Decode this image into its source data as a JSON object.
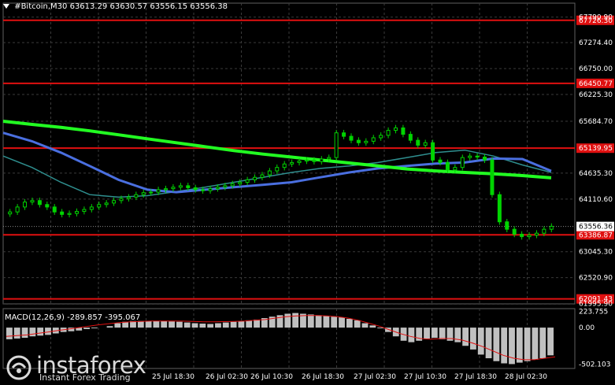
{
  "header": {
    "symbol": "#Bitcoin,M30",
    "ohlc": "63613.29 63630.57 63556.15 63556.38"
  },
  "macd": {
    "label": "MACD(12,26,9) -289.857 -395.067"
  },
  "logo": {
    "brand": "instaforex",
    "tagline": "Instant Forex Trading",
    "icon": "instaforex-logo-icon"
  },
  "colors": {
    "background": "#000000",
    "grid": "#3a3a3a",
    "candle": "#00d400",
    "ma_green": "#22ff22",
    "ma_blue": "#4a6fe0",
    "ma_teal": "#2f8f8f",
    "level": "#e01010",
    "current_price_box": "#ffffff",
    "macd_hist": "#c0c0c0",
    "macd_signal": "#e01010"
  },
  "chart_data": {
    "type": "candlestick",
    "title": "#Bitcoin,M30",
    "price_axis": {
      "ticks": [
        "67790.90",
        "67274.40",
        "66750.00",
        "66225.30",
        "65684.70",
        "64635.30",
        "64110.60",
        "63045.30",
        "62520.90",
        "61995.90"
      ],
      "ylim": [
        61990,
        67850
      ]
    },
    "time_axis": {
      "labels": [
        "25 Jul 18:30",
        "26 Jul 02:30",
        "26 Jul 10:30",
        "26 Jul 18:30",
        "27 Jul 02:30",
        "27 Jul 10:30",
        "27 Jul 18:30",
        "28 Jul 02:30"
      ]
    },
    "levels": [
      {
        "price": 67726.3,
        "label": "67726.30"
      },
      {
        "price": 66450.77,
        "label": "66450.77"
      },
      {
        "price": 65139.95,
        "label": "65139.95"
      },
      {
        "price": 63386.87,
        "label": "63386.87"
      },
      {
        "price": 62091.43,
        "label": "62091.43"
      }
    ],
    "current_price": {
      "price": 63556.36,
      "label": "63556.36"
    },
    "close": [
      63850,
      63950,
      64050,
      64080,
      64000,
      63950,
      63850,
      63800,
      63820,
      63860,
      63900,
      63950,
      64000,
      64030,
      64080,
      64120,
      64150,
      64200,
      64240,
      64250,
      64300,
      64320,
      64350,
      64380,
      64340,
      64300,
      64280,
      64320,
      64350,
      64380,
      64420,
      64450,
      64500,
      64550,
      64600,
      64680,
      64750,
      64820,
      64850,
      64880,
      64900,
      64870,
      64920,
      64950,
      65450,
      65380,
      65300,
      65250,
      65280,
      65350,
      65400,
      65500,
      65550,
      65420,
      65300,
      65200,
      65250,
      64900,
      64850,
      64700,
      64750,
      64950,
      64980,
      64960,
      64900,
      64200,
      63650,
      63500,
      63400,
      63350,
      63380,
      63420,
      63500,
      63560
    ],
    "ma_green": [
      65684,
      65620,
      65560,
      65490,
      65410,
      65330,
      65250,
      65170,
      65090,
      65020,
      64960,
      64900,
      64840,
      64780,
      64720,
      64680,
      64650,
      64620,
      64585,
      64540
    ],
    "ma_blue": [
      65450,
      65280,
      65050,
      64780,
      64500,
      64300,
      64250,
      64300,
      64350,
      64400,
      64450,
      64550,
      64650,
      64730,
      64780,
      64830,
      64850,
      64930,
      64920,
      64680
    ],
    "ma_teal": [
      64980,
      64750,
      64450,
      64200,
      64150,
      64180,
      64260,
      64350,
      64450,
      64550,
      64650,
      64730,
      64780,
      64850,
      64950,
      65050,
      65100,
      64980,
      64800,
      64650
    ],
    "macd": {
      "axis_ticks": [
        "223.755",
        "0.00",
        "-502.103"
      ],
      "ylim": [
        -560,
        260
      ],
      "histogram": [
        -160,
        -150,
        -140,
        -120,
        -110,
        -100,
        -80,
        -60,
        -50,
        -40,
        -20,
        -10,
        0,
        20,
        60,
        80,
        90,
        90,
        90,
        90,
        90,
        85,
        80,
        70,
        60,
        55,
        50,
        60,
        70,
        80,
        90,
        100,
        110,
        130,
        150,
        170,
        190,
        200,
        190,
        180,
        170,
        160,
        150,
        140,
        120,
        100,
        60,
        30,
        -10,
        -60,
        -120,
        -180,
        -200,
        -180,
        -150,
        -140,
        -160,
        -180,
        -200,
        -250,
        -300,
        -370,
        -420,
        -460,
        -490,
        -500,
        -480,
        -460,
        -440,
        -420,
        -380
      ],
      "signal": [
        -120,
        -110,
        -100,
        -80,
        -60,
        -40,
        -20,
        0,
        20,
        40,
        55,
        70,
        80,
        85,
        90,
        90,
        90,
        88,
        85,
        80,
        80,
        82,
        85,
        90,
        100,
        110,
        130,
        150,
        160,
        165,
        165,
        160,
        150,
        130,
        100,
        60,
        20,
        -30,
        -80,
        -120,
        -150,
        -160,
        -150,
        -150,
        -170,
        -210,
        -260,
        -320,
        -380,
        -420,
        -440,
        -440,
        -420,
        -400
      ]
    }
  }
}
